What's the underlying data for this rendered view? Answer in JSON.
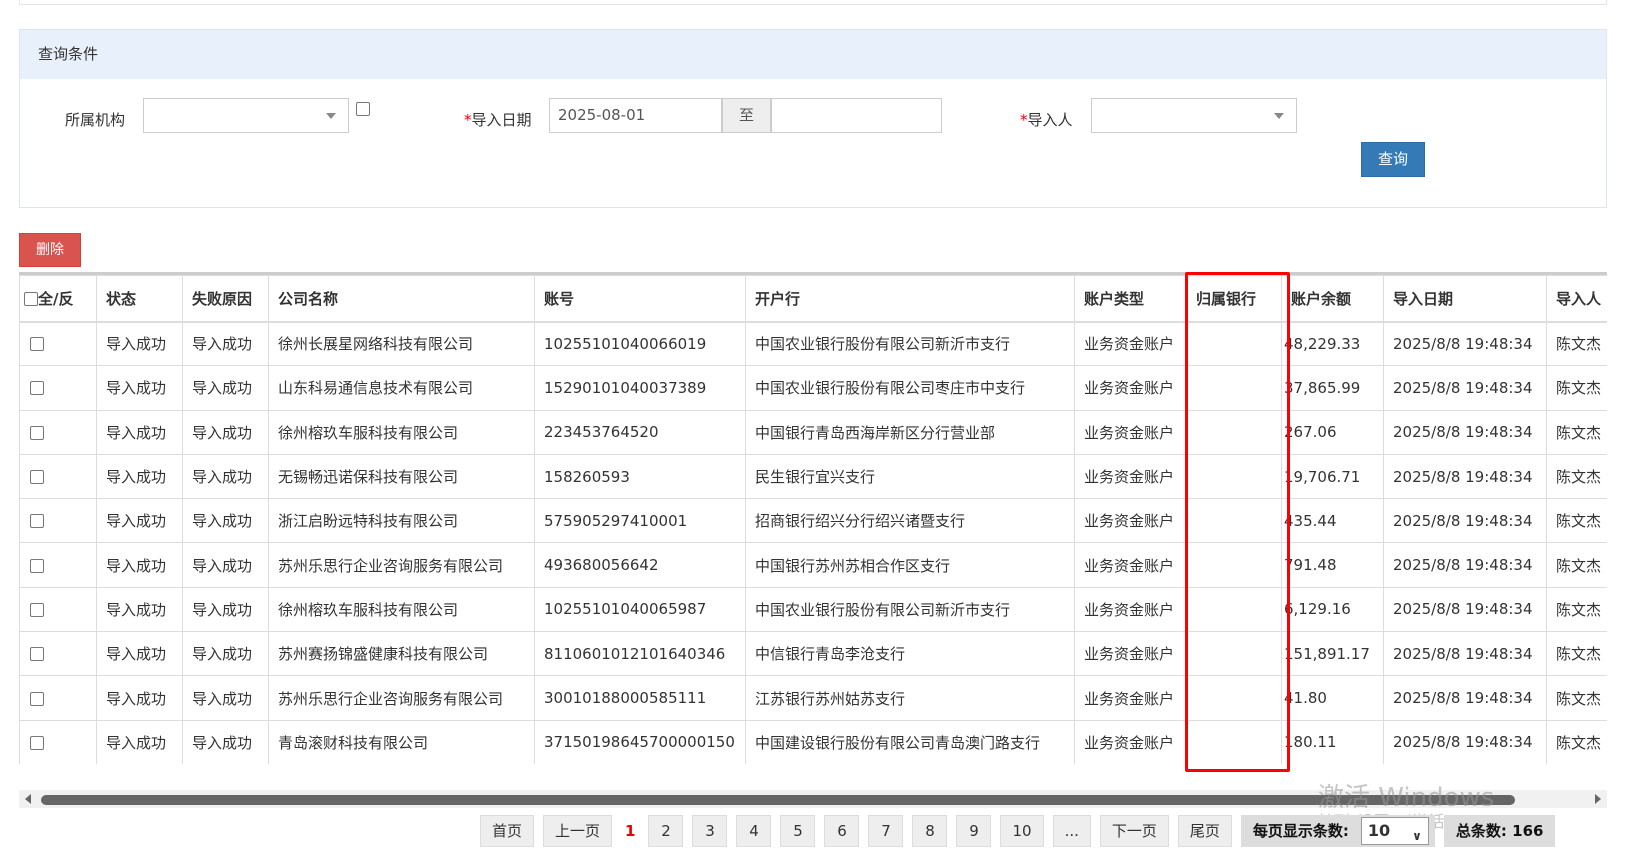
{
  "query": {
    "title": "查询条件",
    "org_label": "所属机构",
    "org_value": "",
    "date_label": "导入日期",
    "date_required": "*",
    "date_from": "2025-08-01",
    "date_to_sep": "至",
    "date_to": "",
    "importer_label": "导入人",
    "importer_required": "*",
    "importer_value": "",
    "query_button": "查询"
  },
  "toolbar": {
    "delete_button": "删除"
  },
  "table": {
    "headers": [
      "全/反",
      "状态",
      "失败原因",
      "公司名称",
      "账号",
      "开户行",
      "账户类型",
      "归属银行",
      "账户余额",
      "导入日期",
      "导入人"
    ],
    "highlight_column": "归属银行",
    "highlight_color": "#ff0000",
    "rows": [
      [
        "导入成功",
        "导入成功",
        "徐州长展星网络科技有限公司",
        "10255101040066019",
        "中国农业银行股份有限公司新沂市支行",
        "业务资金账户",
        "",
        "48,229.33",
        "2025/8/8 19:48:34",
        "陈文杰"
      ],
      [
        "导入成功",
        "导入成功",
        "山东科易通信息技术有限公司",
        "15290101040037389",
        "中国农业银行股份有限公司枣庄市中支行",
        "业务资金账户",
        "",
        "37,865.99",
        "2025/8/8 19:48:34",
        "陈文杰"
      ],
      [
        "导入成功",
        "导入成功",
        "徐州榕玖车服科技有限公司",
        "223453764520",
        "中国银行青岛西海岸新区分行营业部",
        "业务资金账户",
        "",
        "267.06",
        "2025/8/8 19:48:34",
        "陈文杰"
      ],
      [
        "导入成功",
        "导入成功",
        "无锡畅迅诺保科技有限公司",
        "158260593",
        "民生银行宜兴支行",
        "业务资金账户",
        "",
        "19,706.71",
        "2025/8/8 19:48:34",
        "陈文杰"
      ],
      [
        "导入成功",
        "导入成功",
        "浙江启盼远特科技有限公司",
        "575905297410001",
        "招商银行绍兴分行绍兴诸暨支行",
        "业务资金账户",
        "",
        "435.44",
        "2025/8/8 19:48:34",
        "陈文杰"
      ],
      [
        "导入成功",
        "导入成功",
        "苏州乐思行企业咨询服务有限公司",
        "493680056642",
        "中国银行苏州苏相合作区支行",
        "业务资金账户",
        "",
        "791.48",
        "2025/8/8 19:48:34",
        "陈文杰"
      ],
      [
        "导入成功",
        "导入成功",
        "徐州榕玖车服科技有限公司",
        "10255101040065987",
        "中国农业银行股份有限公司新沂市支行",
        "业务资金账户",
        "",
        "6,129.16",
        "2025/8/8 19:48:34",
        "陈文杰"
      ],
      [
        "导入成功",
        "导入成功",
        "苏州赛扬锦盛健康科技有限公司",
        "8110601012101640346",
        "中信银行青岛李沧支行",
        "业务资金账户",
        "",
        "151,891.17",
        "2025/8/8 19:48:34",
        "陈文杰"
      ],
      [
        "导入成功",
        "导入成功",
        "苏州乐思行企业咨询服务有限公司",
        "30010188000585111",
        "江苏银行苏州姑苏支行",
        "业务资金账户",
        "",
        "41.80",
        "2025/8/8 19:48:34",
        "陈文杰"
      ],
      [
        "导入成功",
        "导入成功",
        "青岛滚财科技有限公司",
        "37150198645700000150",
        "中国建设银行股份有限公司青岛澳门路支行",
        "业务资金账户",
        "",
        "180.11",
        "2025/8/8 19:48:34",
        "陈文杰"
      ]
    ]
  },
  "pager": {
    "first": "首页",
    "prev": "上一页",
    "current": "1",
    "pages": [
      "2",
      "3",
      "4",
      "5",
      "6",
      "7",
      "8",
      "9",
      "10"
    ],
    "ellipsis": "...",
    "next": "下一页",
    "last": "尾页",
    "page_size_label": "每页显示条数:",
    "page_size": "10",
    "total_label": "总条数: 166"
  },
  "watermark": {
    "line1": "激活 Windows",
    "line2": "转到\"设置\"以激活 Windows"
  }
}
